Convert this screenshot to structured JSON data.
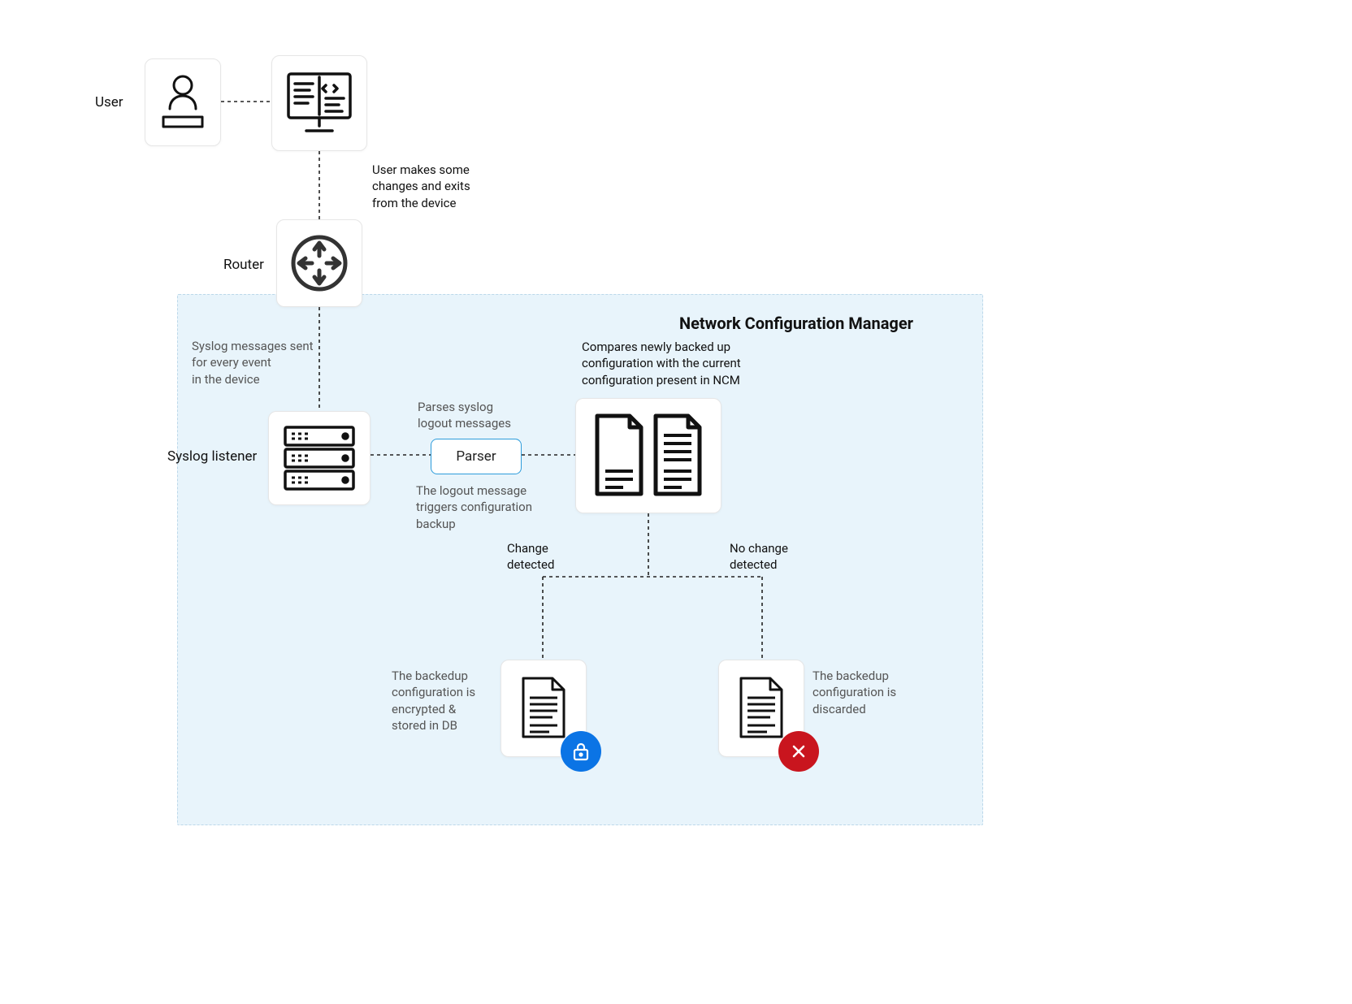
{
  "labels": {
    "user": "User",
    "router": "Router",
    "syslogListener": "Syslog listener",
    "parser": "Parser",
    "ncmTitle": "Network Configuration Manager"
  },
  "captions": {
    "userExit": "User makes some\nchanges and exits\nfrom the device",
    "syslogSent": "Syslog messages sent\nfor every event\nin the device",
    "parsesSyslog": "Parses syslog\nlogout messages",
    "logoutTrigger": "The logout message\ntriggers configuration\nbackup",
    "compares": "Compares newly backed up\nconfiguration with the current\nconfiguration present in NCM",
    "changeDetected": "Change\ndetected",
    "noChangeDetected": "No change\ndetected",
    "storedInDb": "The backedup\nconfiguration is\nencrypted &\nstored in DB",
    "discarded": "The backedup\nconfiguration is\ndiscarded"
  },
  "icons": {
    "user": "user-at-desk-icon",
    "terminal": "terminal-monitor-icon",
    "router": "router-icon",
    "server": "server-stack-icon",
    "documentPair": "document-pair-icon",
    "documentSingle": "document-icon",
    "lock": "lock-icon",
    "x": "x-icon"
  },
  "colors": {
    "accentBlue": "#0b74e5",
    "accentRed": "#c9151e",
    "regionFill": "#e8f4fb",
    "regionBorder": "#bcd8ea",
    "parserBorder": "#2d9cdb"
  }
}
